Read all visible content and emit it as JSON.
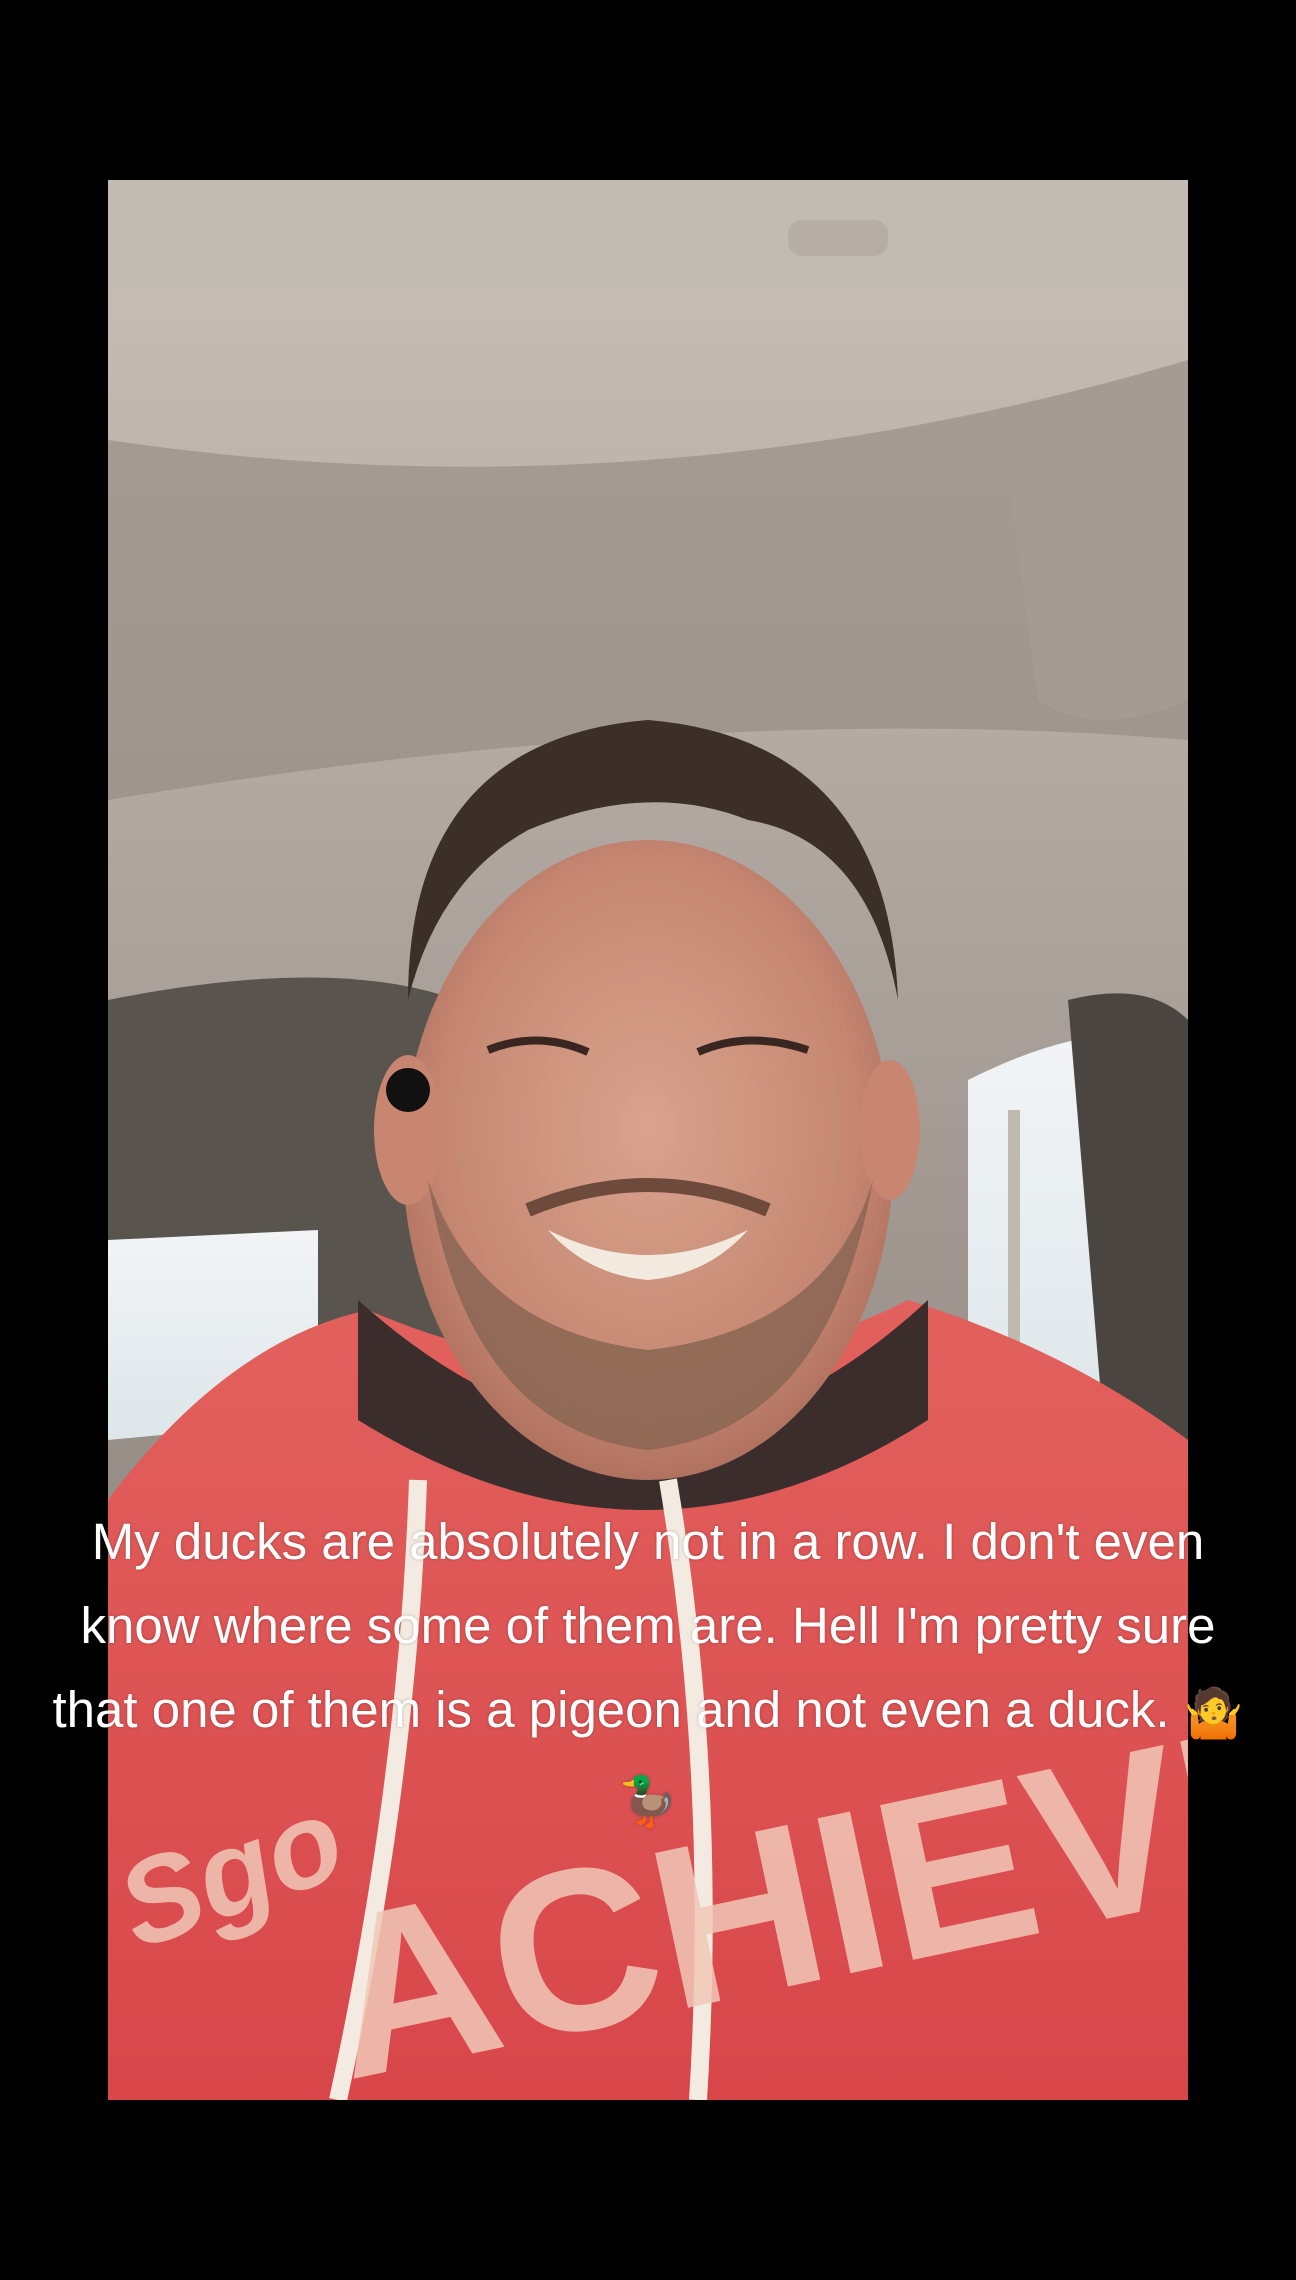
{
  "caption": {
    "text": "My ducks are absolutely not in a row. I don't even know where some of them are. Hell I'm pretty sure that one of them is a pigeon and not even a duck.",
    "emoji": [
      "person-shrugging-emoji",
      "duck-emoji"
    ]
  },
  "hoodie": {
    "print_text": "ACHIEVE",
    "script_text": "Sgo",
    "color": "#e0504c"
  },
  "colors": {
    "background": "#000000",
    "caption": "#ffffff"
  }
}
